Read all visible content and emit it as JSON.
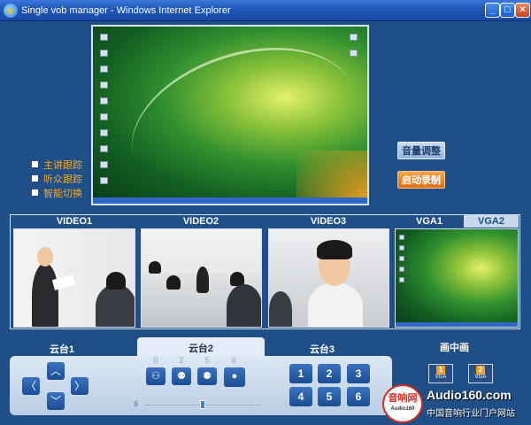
{
  "window": {
    "title": "Single vob manager - Windows Internet Explorer",
    "controls": {
      "minimize": "_",
      "maximize": "□",
      "close": "×"
    }
  },
  "tracking_options": [
    {
      "label": "主讲跟踪",
      "checked": false
    },
    {
      "label": "听众跟踪",
      "checked": false
    },
    {
      "label": "智能切换",
      "checked": false
    }
  ],
  "actions": {
    "volume": "音量调整",
    "record": "启动录制"
  },
  "video_sources": [
    "VIDEO1",
    "VIDEO2",
    "VIDEO3"
  ],
  "vga_tabs": [
    "VGA1",
    "VGA2"
  ],
  "ptz": {
    "tabs": [
      "云台1",
      "云台2",
      "云台3"
    ],
    "active_tab": "云台2",
    "camera_numbers": [
      "0",
      "2",
      "5",
      "8"
    ],
    "zoom_value": "6",
    "presets": [
      "1",
      "2",
      "3",
      "4",
      "5",
      "6"
    ]
  },
  "pip": {
    "label": "画中画",
    "buttons": [
      {
        "number": "1",
        "text": "VGA"
      },
      {
        "number": "2",
        "text": "VGA"
      }
    ]
  },
  "watermark": {
    "logo_text": "音响网",
    "logo_sub": "Audio160",
    "site": "Audio160.com",
    "tagline": "中国音响行业门户网站"
  },
  "icons": [
    "ie-icon",
    "arrow-up-icon",
    "arrow-down-icon",
    "arrow-left-icon",
    "arrow-right-icon",
    "camera-group-icon",
    "user-icon"
  ],
  "colors": {
    "background": "#1f4f86",
    "accent_orange": "#f0a830",
    "panel": "#dde8f4"
  }
}
